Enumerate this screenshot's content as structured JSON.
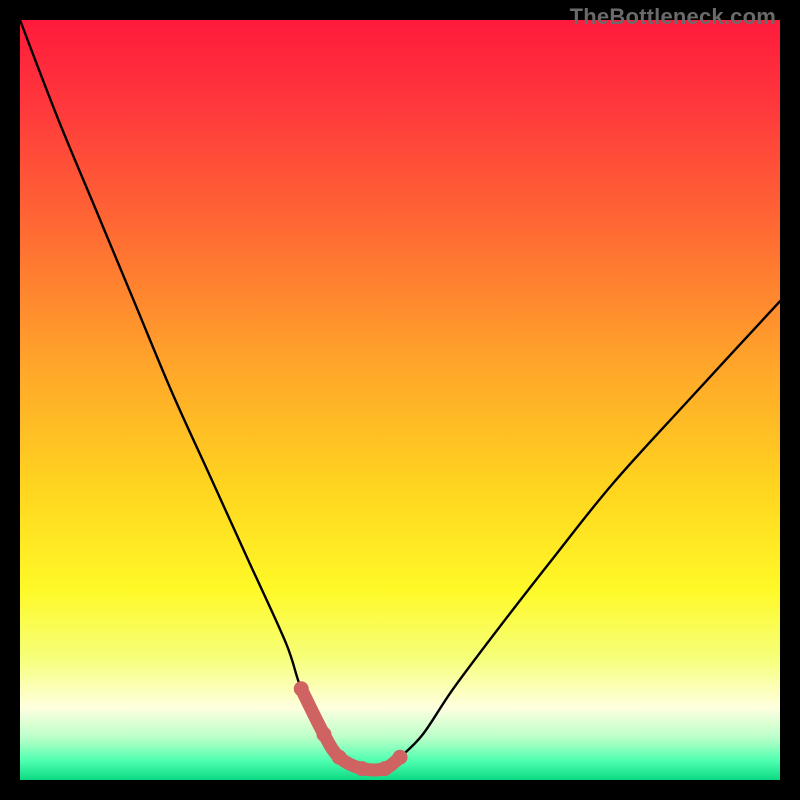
{
  "watermark": "TheBottleneck.com",
  "chart_data": {
    "type": "line",
    "title": "",
    "xlabel": "",
    "ylabel": "",
    "xlim": [
      0,
      100
    ],
    "ylim": [
      0,
      100
    ],
    "series": [
      {
        "name": "bottleneck-curve",
        "x": [
          0,
          5,
          10,
          15,
          20,
          25,
          30,
          35,
          37,
          40,
          42,
          45,
          48,
          50,
          53,
          57,
          63,
          70,
          78,
          88,
          100
        ],
        "y": [
          100,
          87,
          75,
          63,
          51,
          40,
          29,
          18,
          12,
          6,
          3,
          1.5,
          1.5,
          3,
          6,
          12,
          20,
          29,
          39,
          50,
          63
        ]
      }
    ],
    "highlight_region": {
      "name": "u-bottom",
      "index_start": 8,
      "index_end": 13,
      "color": "#cf6362"
    },
    "background_gradient": {
      "stops": [
        {
          "pos": 0.0,
          "color": "#ff1a3c"
        },
        {
          "pos": 0.12,
          "color": "#ff3a3c"
        },
        {
          "pos": 0.28,
          "color": "#ff6b33"
        },
        {
          "pos": 0.45,
          "color": "#ffa42a"
        },
        {
          "pos": 0.62,
          "color": "#ffd61f"
        },
        {
          "pos": 0.75,
          "color": "#fff928"
        },
        {
          "pos": 0.84,
          "color": "#f6ff7a"
        },
        {
          "pos": 0.905,
          "color": "#ffffe0"
        },
        {
          "pos": 0.945,
          "color": "#b8ffc8"
        },
        {
          "pos": 0.975,
          "color": "#4dffb0"
        },
        {
          "pos": 1.0,
          "color": "#0cd983"
        }
      ]
    }
  }
}
